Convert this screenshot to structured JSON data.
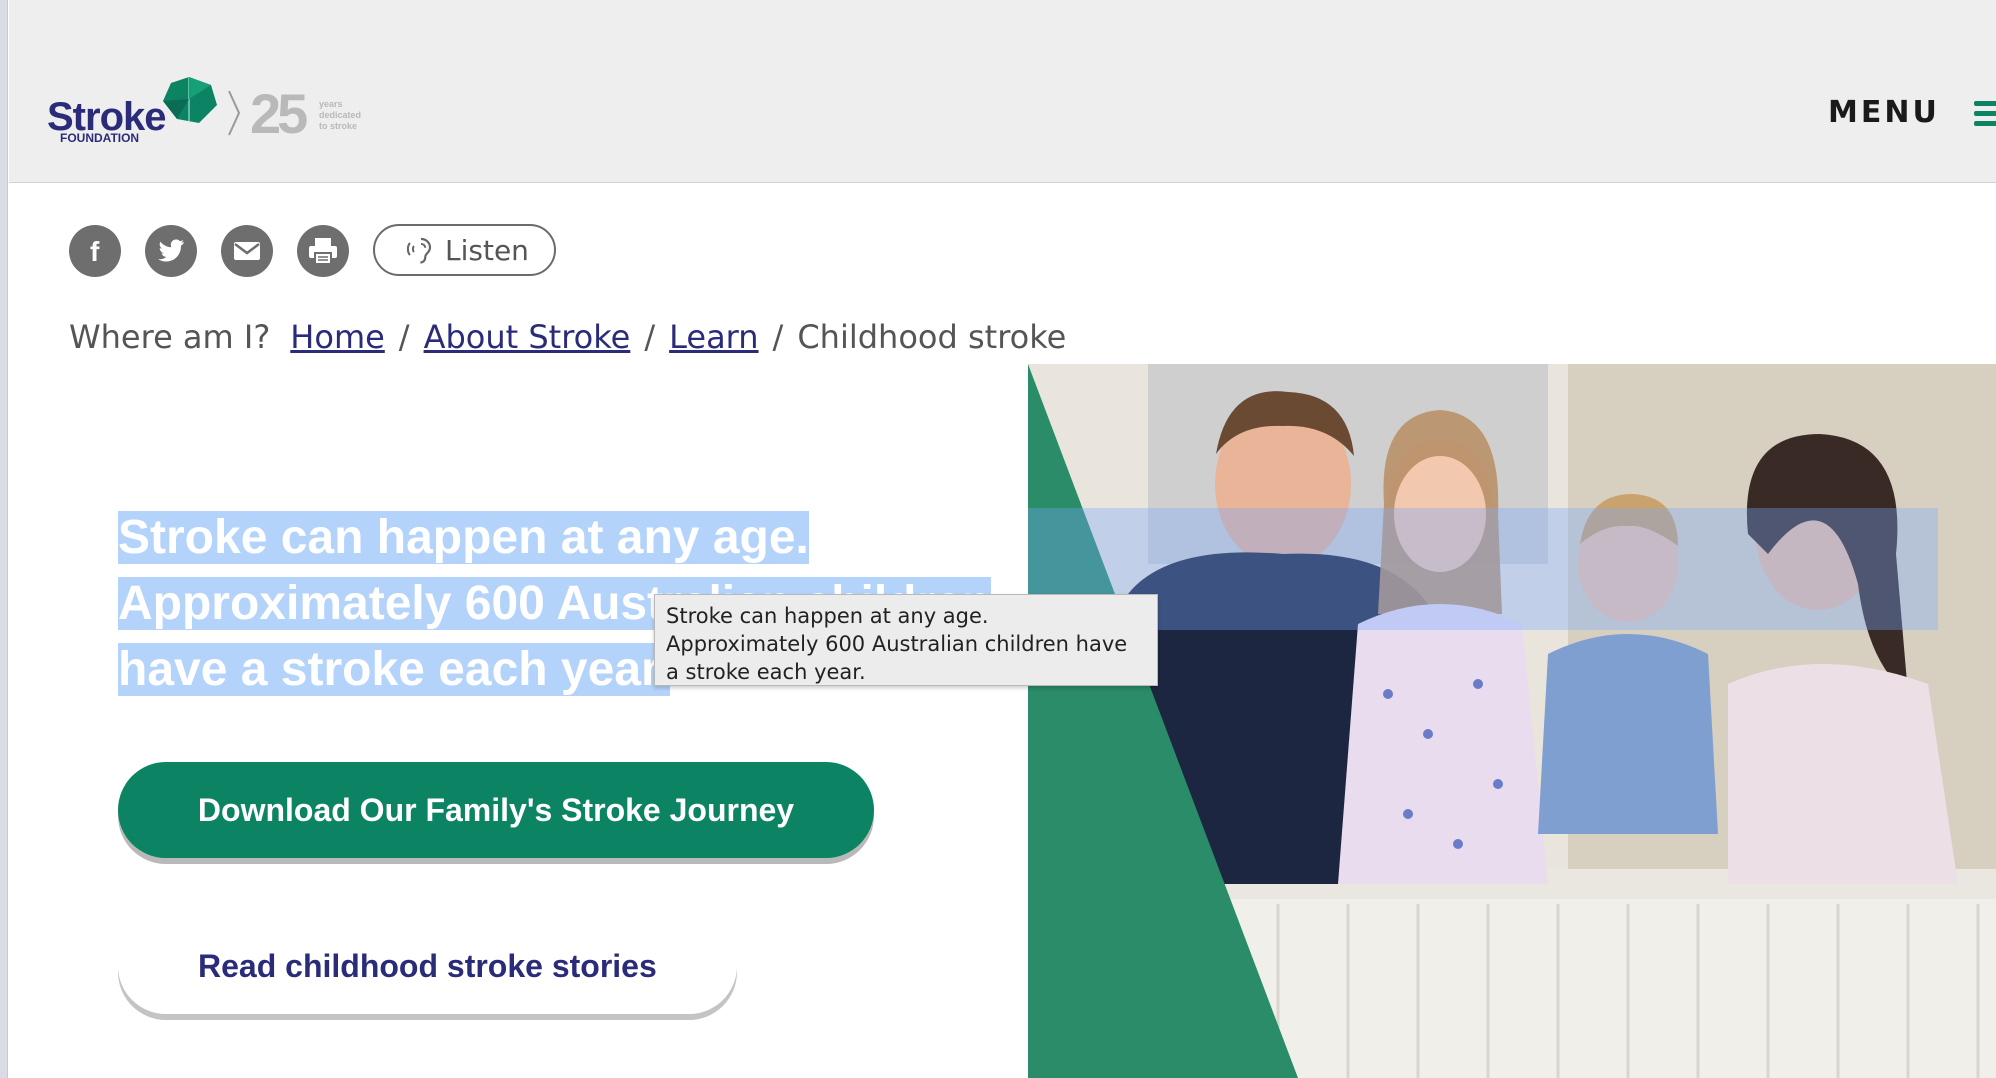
{
  "header": {
    "logo_word": "Stroke",
    "logo_sub": "FOUNDATION",
    "logo_number": "25",
    "logo_tagline": [
      "years",
      "dedicated",
      "to stroke"
    ],
    "menu_label": "MENU"
  },
  "share": {
    "icons": [
      "facebook-icon",
      "twitter-icon",
      "email-icon",
      "print-icon"
    ],
    "listen_label": "Listen"
  },
  "breadcrumb": {
    "prefix": "Where am I?",
    "items": [
      "Home",
      "About Stroke",
      "Learn"
    ],
    "current": "Childhood stroke"
  },
  "hero": {
    "heading": "Stroke can happen at any age. Approximately 600 Australian children have a stroke each year.",
    "tooltip": "Stroke can happen at any age. Approximately 600 Australian children have a stroke each year.",
    "primary_button": "Download Our Family's Stroke Journey",
    "secondary_button": "Read childhood stroke stories"
  },
  "colors": {
    "brand_green": "#0c8464",
    "brand_navy": "#2a2c79",
    "selection": "#b4d3fb"
  }
}
